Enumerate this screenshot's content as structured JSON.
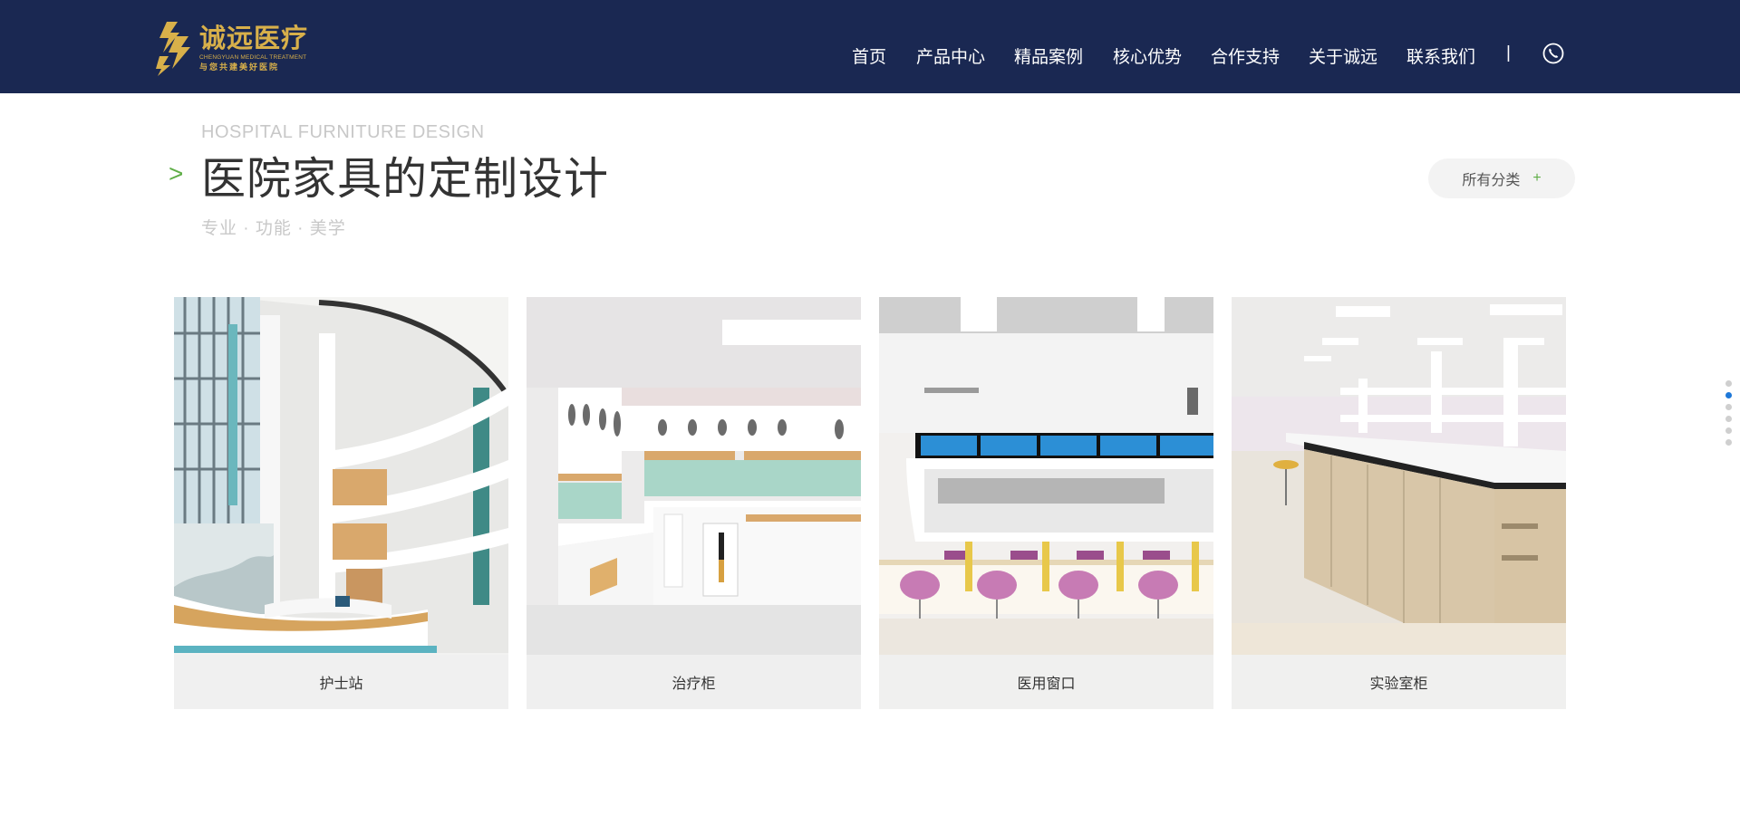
{
  "brand": {
    "name_cn": "诚远医疗",
    "name_en": "CHENGYUAN MEDICAL TREATMENT",
    "slogan": "与您共建美好医院",
    "gold": "#d8b04a"
  },
  "header_bg": "#1a2852",
  "nav": {
    "items": [
      {
        "label": "首页"
      },
      {
        "label": "产品中心"
      },
      {
        "label": "精品案例"
      },
      {
        "label": "核心优势"
      },
      {
        "label": "合作支持"
      },
      {
        "label": "关于诚远"
      },
      {
        "label": "联系我们"
      }
    ],
    "separator": "|",
    "phone_icon": "phone-icon"
  },
  "section": {
    "en_title": "HOSPITAL FURNITURE DESIGN",
    "arrow": ">",
    "cn_title": "医院家具的定制设计",
    "subtitle": "专业 · 功能 · 美学",
    "all_categories": {
      "label": "所有分类",
      "plus": "+"
    },
    "accent": "#5fae47"
  },
  "cards": [
    {
      "caption": "护士站"
    },
    {
      "caption": "治疗柜"
    },
    {
      "caption": "医用窗口"
    },
    {
      "caption": "实验室柜"
    }
  ],
  "pager": {
    "count": 6,
    "active_index": 1,
    "active_color": "#1e78d8"
  }
}
